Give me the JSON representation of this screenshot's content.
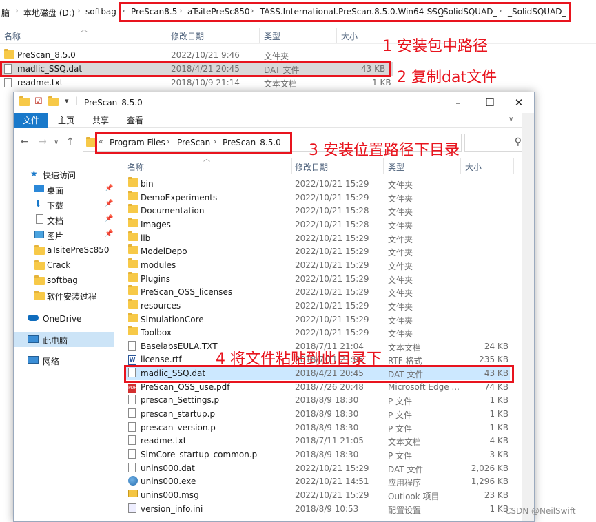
{
  "bg_window": {
    "address": [
      "脑",
      "本地磁盘 (D:)",
      "softbag",
      "PreScan8.5",
      "aTsitePreSc850",
      "TASS.International.PreScan.8.5.0.Win64-SSQ",
      "_SolidSQUAD_",
      "_SolidSQUAD_"
    ],
    "columns": {
      "name": "名称",
      "date": "修改日期",
      "type": "类型",
      "size": "大小"
    },
    "files": [
      {
        "name": "PreScan_8.5.0",
        "date": "2022/10/21 9:46",
        "type": "文件夹",
        "size": "",
        "icon": "folder"
      },
      {
        "name": "madlic_SSQ.dat",
        "date": "2018/4/21 20:45",
        "type": "DAT 文件",
        "size": "43 KB",
        "icon": "doc"
      },
      {
        "name": "readme.txt",
        "date": "2018/10/9 21:14",
        "type": "文本文档",
        "size": "1 KB",
        "icon": "doc"
      }
    ]
  },
  "window": {
    "title": "PreScan_8.5.0",
    "ribbon_tabs": [
      "文件",
      "主页",
      "共享",
      "查看"
    ],
    "address": [
      "Program Files",
      "PreScan",
      "PreScan_8.5.0"
    ],
    "columns": {
      "name": "名称",
      "date": "修改日期",
      "type": "类型",
      "size": "大小"
    },
    "nav": [
      {
        "label": "快速访问",
        "icon": "star",
        "pinned": false
      },
      {
        "label": "桌面",
        "icon": "desktop",
        "pinned": true
      },
      {
        "label": "下载",
        "icon": "download",
        "pinned": true
      },
      {
        "label": "文档",
        "icon": "document",
        "pinned": true
      },
      {
        "label": "图片",
        "icon": "picture",
        "pinned": true
      },
      {
        "label": "aTsitePreSc850",
        "icon": "folder",
        "pinned": false
      },
      {
        "label": "Crack",
        "icon": "folder",
        "pinned": false
      },
      {
        "label": "softbag",
        "icon": "folder",
        "pinned": false
      },
      {
        "label": "软件安装过程",
        "icon": "folder",
        "pinned": false
      },
      {
        "label": "OneDrive",
        "icon": "cloud",
        "pinned": false
      },
      {
        "label": "此电脑",
        "icon": "computer",
        "pinned": false
      },
      {
        "label": "网络",
        "icon": "network",
        "pinned": false
      }
    ],
    "files": [
      {
        "name": "bin",
        "date": "2022/10/21 15:29",
        "type": "文件夹",
        "size": "",
        "icon": "folder"
      },
      {
        "name": "DemoExperiments",
        "date": "2022/10/21 15:29",
        "type": "文件夹",
        "size": "",
        "icon": "folder"
      },
      {
        "name": "Documentation",
        "date": "2022/10/21 15:28",
        "type": "文件夹",
        "size": "",
        "icon": "folder"
      },
      {
        "name": "Images",
        "date": "2022/10/21 15:28",
        "type": "文件夹",
        "size": "",
        "icon": "folder"
      },
      {
        "name": "lib",
        "date": "2022/10/21 15:29",
        "type": "文件夹",
        "size": "",
        "icon": "folder"
      },
      {
        "name": "ModelDepo",
        "date": "2022/10/21 15:29",
        "type": "文件夹",
        "size": "",
        "icon": "folder"
      },
      {
        "name": "modules",
        "date": "2022/10/21 15:29",
        "type": "文件夹",
        "size": "",
        "icon": "folder"
      },
      {
        "name": "Plugins",
        "date": "2022/10/21 15:29",
        "type": "文件夹",
        "size": "",
        "icon": "folder"
      },
      {
        "name": "PreScan_OSS_licenses",
        "date": "2022/10/21 15:29",
        "type": "文件夹",
        "size": "",
        "icon": "folder"
      },
      {
        "name": "resources",
        "date": "2022/10/21 15:29",
        "type": "文件夹",
        "size": "",
        "icon": "folder"
      },
      {
        "name": "SimulationCore",
        "date": "2022/10/21 15:29",
        "type": "文件夹",
        "size": "",
        "icon": "folder"
      },
      {
        "name": "Toolbox",
        "date": "2022/10/21 15:29",
        "type": "文件夹",
        "size": "",
        "icon": "folder"
      },
      {
        "name": "BaselabsEULA.TXT",
        "date": "2018/7/11 21:04",
        "type": "文本文档",
        "size": "24 KB",
        "icon": "doc"
      },
      {
        "name": "license.rtf",
        "date": "2018/7/11 21:05",
        "type": "RTF 格式",
        "size": "235 KB",
        "icon": "rtf"
      },
      {
        "name": "madlic_SSQ.dat",
        "date": "2018/4/21 20:45",
        "type": "DAT 文件",
        "size": "43 KB",
        "icon": "doc"
      },
      {
        "name": "PreScan_OSS_use.pdf",
        "date": "2018/7/26 20:48",
        "type": "Microsoft Edge ...",
        "size": "74 KB",
        "icon": "pdf"
      },
      {
        "name": "prescan_Settings.p",
        "date": "2018/8/9 18:30",
        "type": "P 文件",
        "size": "1 KB",
        "icon": "doc"
      },
      {
        "name": "prescan_startup.p",
        "date": "2018/8/9 18:30",
        "type": "P 文件",
        "size": "1 KB",
        "icon": "doc"
      },
      {
        "name": "prescan_version.p",
        "date": "2018/8/9 18:30",
        "type": "P 文件",
        "size": "1 KB",
        "icon": "doc"
      },
      {
        "name": "readme.txt",
        "date": "2018/7/11 21:05",
        "type": "文本文档",
        "size": "4 KB",
        "icon": "doc"
      },
      {
        "name": "SimCore_startup_common.p",
        "date": "2018/8/9 18:30",
        "type": "P 文件",
        "size": "3 KB",
        "icon": "doc"
      },
      {
        "name": "unins000.dat",
        "date": "2022/10/21 15:29",
        "type": "DAT 文件",
        "size": "2,026 KB",
        "icon": "doc"
      },
      {
        "name": "unins000.exe",
        "date": "2022/10/21 14:51",
        "type": "应用程序",
        "size": "1,296 KB",
        "icon": "exe"
      },
      {
        "name": "unins000.msg",
        "date": "2022/10/21 15:29",
        "type": "Outlook 项目",
        "size": "23 KB",
        "icon": "msg"
      },
      {
        "name": "version_info.ini",
        "date": "2018/8/9 10:53",
        "type": "配置设置",
        "size": "1 KB",
        "icon": "ini"
      }
    ]
  },
  "annotations": {
    "step1": "1 安装包中路径",
    "step2": "2 复制dat文件",
    "step3": "3 安装位置路径下目录",
    "step4": "4 将文件粘贴到此目录下",
    "color": "#e8141e"
  },
  "watermark": "CSDN @NeilSwift"
}
